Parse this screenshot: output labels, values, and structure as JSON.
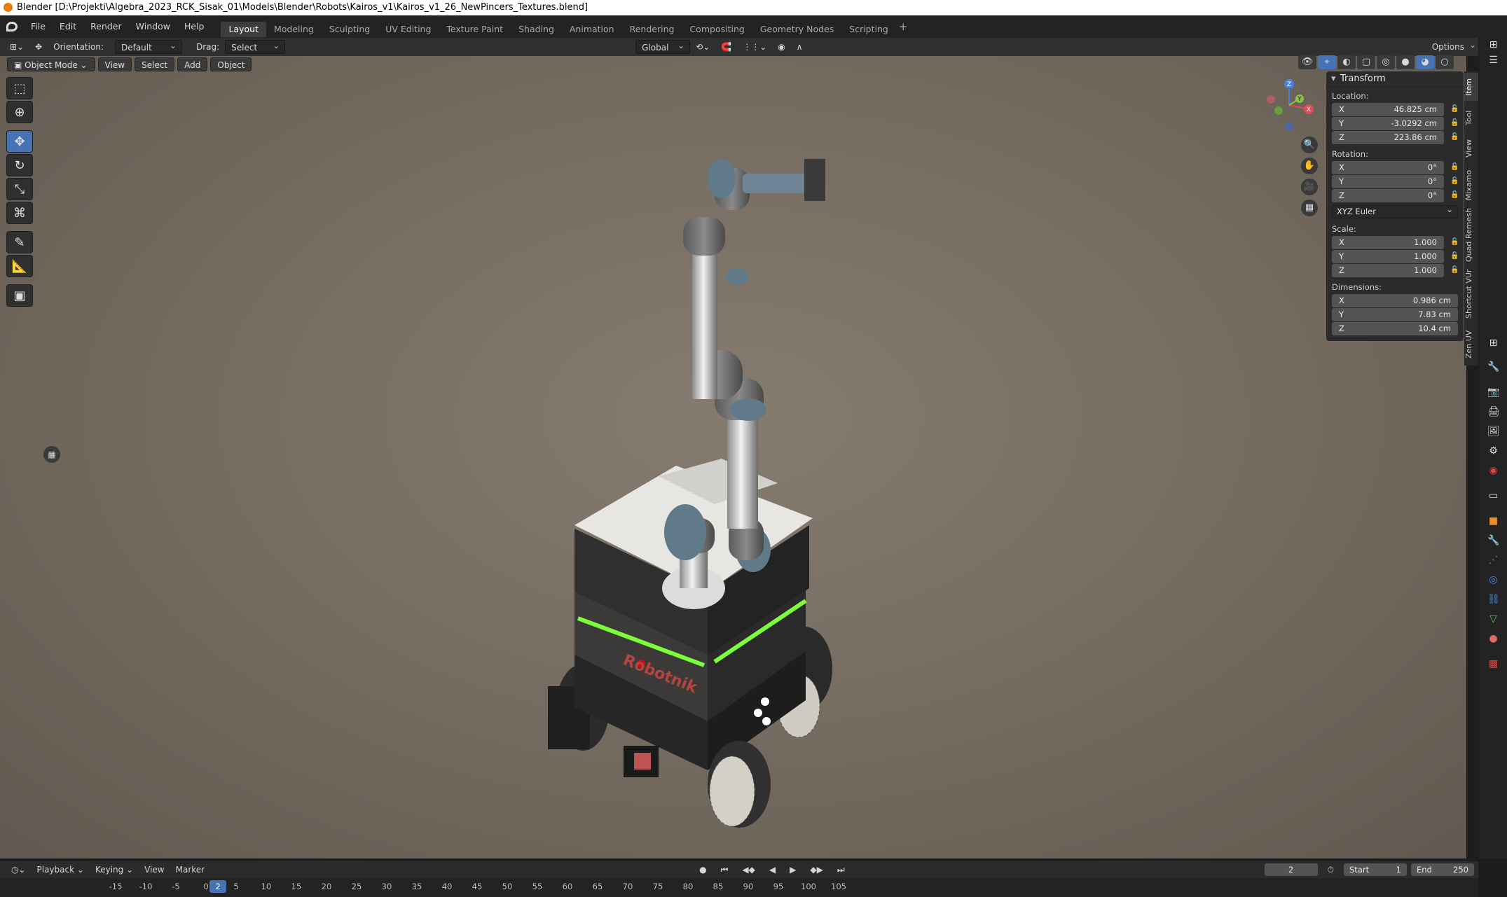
{
  "window": {
    "title": "Blender [D:\\Projekti\\Algebra_2023_RCK_Sisak_01\\Models\\Blender\\Robots\\Kairos_v1\\Kairos_v1_26_NewPincers_Textures.blend]"
  },
  "menu": [
    "File",
    "Edit",
    "Render",
    "Window",
    "Help"
  ],
  "workspaces": [
    "Layout",
    "Modeling",
    "Sculpting",
    "UV Editing",
    "Texture Paint",
    "Shading",
    "Animation",
    "Rendering",
    "Compositing",
    "Geometry Nodes",
    "Scripting"
  ],
  "active_workspace": "Layout",
  "toolbar": {
    "orientation_label": "Orientation:",
    "orientation_value": "Default",
    "drag_label": "Drag:",
    "drag_value": "Select Box",
    "transform_orientation": "Global",
    "options_label": "Options"
  },
  "viewport_header": {
    "mode": "Object Mode",
    "menus": [
      "View",
      "Select",
      "Add",
      "Object"
    ]
  },
  "transform_panel": {
    "title": "Transform",
    "location_label": "Location:",
    "location": {
      "x": "46.825 cm",
      "y": "-3.0292 cm",
      "z": "223.86 cm"
    },
    "rotation_label": "Rotation:",
    "rotation": {
      "x": "0°",
      "y": "0°",
      "z": "0°"
    },
    "rotation_mode": "XYZ Euler",
    "scale_label": "Scale:",
    "scale": {
      "x": "1.000",
      "y": "1.000",
      "z": "1.000"
    },
    "dimensions_label": "Dimensions:",
    "dimensions": {
      "x": "0.986 cm",
      "y": "7.83 cm",
      "z": "10.4 cm"
    }
  },
  "axis_labels": {
    "x": "X",
    "y": "Y",
    "z": "Z"
  },
  "sidebar_tabs": [
    "Item",
    "Tool",
    "View",
    "Mixamo",
    "Quad Remesh",
    "Shortcut VUr",
    "Zen UV"
  ],
  "robot_brand": "Robotnik",
  "timeline": {
    "menus": [
      "Playback",
      "Keying",
      "View",
      "Marker"
    ],
    "current_frame": "2",
    "start_label": "Start",
    "start": "1",
    "end_label": "End",
    "end": "250",
    "ticks": [
      "-15",
      "-10",
      "-5",
      "0",
      "2",
      "5",
      "10",
      "15",
      "20",
      "25",
      "30",
      "35",
      "40",
      "45",
      "50",
      "55",
      "60",
      "65",
      "70",
      "75",
      "80",
      "85",
      "90",
      "95",
      "100",
      "105"
    ]
  },
  "colors": {
    "accent": "#4772b3",
    "viewport_bg": "#7b7167",
    "led": "#7cff3a"
  }
}
